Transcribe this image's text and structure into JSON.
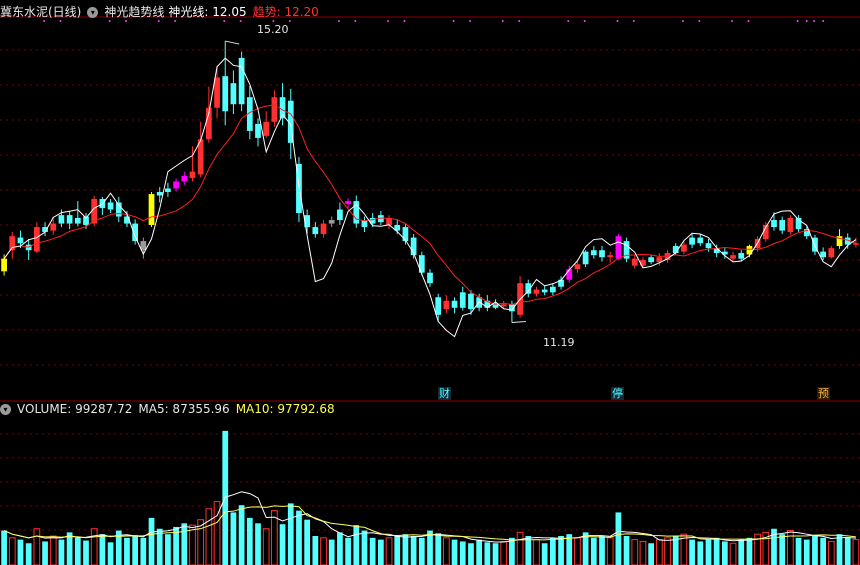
{
  "header": {
    "stock_name": "冀东水泥(日线)",
    "indicator_name": "神光趋势线",
    "line_label": "神光线: 12.05",
    "trend_label": "趋势: 12.20"
  },
  "volume_header": {
    "volume": "VOLUME: 99287.72",
    "ma5": "MA5: 87355.96",
    "ma10": "MA10: 97792.68"
  },
  "annotations": {
    "high": "15.20",
    "low": "11.19",
    "marker_cai": "财",
    "marker_ting": "停",
    "marker_yu": "预"
  },
  "colors": {
    "up": "#ff3030",
    "down": "#54ffff",
    "magenta": "#ff00ff",
    "yellow": "#ffff00",
    "gray": "#9a9a9a",
    "trend_line": "#ff2020",
    "shenguang_line": "#ffffff",
    "ma10_line": "#ffff60"
  },
  "chart_data": {
    "type": "candlestick",
    "y_range": [
      10.3,
      15.5
    ],
    "volume_range": [
      0,
      160000
    ],
    "candles": [
      {
        "o": 11.92,
        "c": 12.1,
        "h": 12.16,
        "l": 11.86,
        "v": 38000,
        "color": "yellow"
      },
      {
        "o": 12.22,
        "c": 12.42,
        "h": 12.48,
        "l": 12.1,
        "v": 30000,
        "color": "up"
      },
      {
        "o": 12.4,
        "c": 12.32,
        "h": 12.5,
        "l": 12.25,
        "v": 28000,
        "color": "down"
      },
      {
        "o": 12.3,
        "c": 12.22,
        "h": 12.38,
        "l": 12.08,
        "v": 24000,
        "color": "down"
      },
      {
        "o": 12.2,
        "c": 12.55,
        "h": 12.62,
        "l": 12.18,
        "v": 40000,
        "color": "up"
      },
      {
        "o": 12.55,
        "c": 12.48,
        "h": 12.62,
        "l": 12.42,
        "v": 26000,
        "color": "down"
      },
      {
        "o": 12.5,
        "c": 12.6,
        "h": 12.7,
        "l": 12.44,
        "v": 32000,
        "color": "up"
      },
      {
        "o": 12.6,
        "c": 12.72,
        "h": 12.8,
        "l": 12.55,
        "v": 28000,
        "color": "down"
      },
      {
        "o": 12.72,
        "c": 12.6,
        "h": 12.78,
        "l": 12.52,
        "v": 36000,
        "color": "down"
      },
      {
        "o": 12.6,
        "c": 12.68,
        "h": 12.92,
        "l": 12.56,
        "v": 30000,
        "color": "down"
      },
      {
        "o": 12.7,
        "c": 12.58,
        "h": 12.75,
        "l": 12.52,
        "v": 27000,
        "color": "down"
      },
      {
        "o": 12.6,
        "c": 12.95,
        "h": 13.0,
        "l": 12.56,
        "v": 40000,
        "color": "up"
      },
      {
        "o": 12.95,
        "c": 12.82,
        "h": 12.98,
        "l": 12.72,
        "v": 34000,
        "color": "down"
      },
      {
        "o": 12.8,
        "c": 12.9,
        "h": 12.95,
        "l": 12.75,
        "v": 25000,
        "color": "down"
      },
      {
        "o": 12.9,
        "c": 12.7,
        "h": 12.98,
        "l": 12.62,
        "v": 38000,
        "color": "down"
      },
      {
        "o": 12.7,
        "c": 12.6,
        "h": 12.78,
        "l": 12.55,
        "v": 30000,
        "color": "down"
      },
      {
        "o": 12.6,
        "c": 12.35,
        "h": 12.66,
        "l": 12.3,
        "v": 33000,
        "color": "down"
      },
      {
        "o": 12.35,
        "c": 12.22,
        "h": 12.4,
        "l": 12.1,
        "v": 30000,
        "color": "gray"
      },
      {
        "o": 12.58,
        "c": 13.02,
        "h": 13.05,
        "l": 12.55,
        "v": 52000,
        "color": "yellow"
      },
      {
        "o": 13.0,
        "c": 13.05,
        "h": 13.12,
        "l": 12.9,
        "v": 40000,
        "color": "down"
      },
      {
        "o": 13.05,
        "c": 13.1,
        "h": 13.18,
        "l": 12.98,
        "v": 34000,
        "color": "down"
      },
      {
        "o": 13.1,
        "c": 13.2,
        "h": 13.24,
        "l": 13.06,
        "v": 42000,
        "color": "magenta"
      },
      {
        "o": 13.2,
        "c": 13.28,
        "h": 13.34,
        "l": 13.15,
        "v": 46000,
        "color": "magenta"
      },
      {
        "o": 13.25,
        "c": 13.34,
        "h": 13.7,
        "l": 13.2,
        "v": 44000,
        "color": "up"
      },
      {
        "o": 13.3,
        "c": 13.8,
        "h": 14.05,
        "l": 13.26,
        "v": 50000,
        "color": "up"
      },
      {
        "o": 13.8,
        "c": 14.25,
        "h": 14.55,
        "l": 13.75,
        "v": 62000,
        "color": "up"
      },
      {
        "o": 14.25,
        "c": 14.68,
        "h": 14.85,
        "l": 14.1,
        "v": 70000,
        "color": "up"
      },
      {
        "o": 14.7,
        "c": 14.2,
        "h": 15.2,
        "l": 14.0,
        "v": 148000,
        "color": "down"
      },
      {
        "o": 14.6,
        "c": 14.3,
        "h": 14.78,
        "l": 14.16,
        "v": 58000,
        "color": "down"
      },
      {
        "o": 14.3,
        "c": 14.96,
        "h": 15.05,
        "l": 14.2,
        "v": 66000,
        "color": "down"
      },
      {
        "o": 14.4,
        "c": 13.92,
        "h": 14.56,
        "l": 13.8,
        "v": 52000,
        "color": "down"
      },
      {
        "o": 14.02,
        "c": 13.82,
        "h": 14.1,
        "l": 13.7,
        "v": 46000,
        "color": "down"
      },
      {
        "o": 13.85,
        "c": 14.05,
        "h": 14.2,
        "l": 13.82,
        "v": 40000,
        "color": "up"
      },
      {
        "o": 14.05,
        "c": 14.4,
        "h": 14.5,
        "l": 13.98,
        "v": 60000,
        "color": "up"
      },
      {
        "o": 14.4,
        "c": 14.1,
        "h": 14.6,
        "l": 14.0,
        "v": 45000,
        "color": "down"
      },
      {
        "o": 14.35,
        "c": 13.75,
        "h": 14.52,
        "l": 13.52,
        "v": 68000,
        "color": "down"
      },
      {
        "o": 13.45,
        "c": 12.75,
        "h": 13.55,
        "l": 12.62,
        "v": 60000,
        "color": "down"
      },
      {
        "o": 12.72,
        "c": 12.55,
        "h": 12.8,
        "l": 12.46,
        "v": 50000,
        "color": "down"
      },
      {
        "o": 12.55,
        "c": 12.45,
        "h": 12.62,
        "l": 12.4,
        "v": 32000,
        "color": "down"
      },
      {
        "o": 12.45,
        "c": 12.6,
        "h": 12.65,
        "l": 12.4,
        "v": 30000,
        "color": "up"
      },
      {
        "o": 12.6,
        "c": 12.65,
        "h": 12.7,
        "l": 12.55,
        "v": 28000,
        "color": "gray"
      },
      {
        "o": 12.65,
        "c": 12.8,
        "h": 12.9,
        "l": 12.58,
        "v": 36000,
        "color": "down"
      },
      {
        "o": 12.88,
        "c": 12.92,
        "h": 12.96,
        "l": 12.82,
        "v": 30000,
        "color": "magenta"
      },
      {
        "o": 12.92,
        "c": 12.6,
        "h": 13.0,
        "l": 12.54,
        "v": 44000,
        "color": "down"
      },
      {
        "o": 12.65,
        "c": 12.55,
        "h": 12.7,
        "l": 12.48,
        "v": 38000,
        "color": "down"
      },
      {
        "o": 12.6,
        "c": 12.68,
        "h": 12.75,
        "l": 12.55,
        "v": 30000,
        "color": "down"
      },
      {
        "o": 12.72,
        "c": 12.62,
        "h": 12.78,
        "l": 12.58,
        "v": 28000,
        "color": "down"
      },
      {
        "o": 12.68,
        "c": 12.58,
        "h": 12.72,
        "l": 12.52,
        "v": 30000,
        "color": "up"
      },
      {
        "o": 12.58,
        "c": 12.5,
        "h": 12.65,
        "l": 12.45,
        "v": 32000,
        "color": "down"
      },
      {
        "o": 12.55,
        "c": 12.35,
        "h": 12.6,
        "l": 12.3,
        "v": 34000,
        "color": "down"
      },
      {
        "o": 12.4,
        "c": 12.15,
        "h": 12.45,
        "l": 12.1,
        "v": 32000,
        "color": "down"
      },
      {
        "o": 12.15,
        "c": 11.9,
        "h": 12.2,
        "l": 11.86,
        "v": 30000,
        "color": "down"
      },
      {
        "o": 11.9,
        "c": 11.75,
        "h": 11.95,
        "l": 11.7,
        "v": 38000,
        "color": "down"
      },
      {
        "o": 11.55,
        "c": 11.3,
        "h": 11.6,
        "l": 11.2,
        "v": 35000,
        "color": "down"
      },
      {
        "o": 11.38,
        "c": 11.5,
        "h": 11.58,
        "l": 11.32,
        "v": 30000,
        "color": "up"
      },
      {
        "o": 11.5,
        "c": 11.4,
        "h": 11.55,
        "l": 11.32,
        "v": 28000,
        "color": "down"
      },
      {
        "o": 11.4,
        "c": 11.62,
        "h": 11.7,
        "l": 11.36,
        "v": 26000,
        "color": "down"
      },
      {
        "o": 11.6,
        "c": 11.38,
        "h": 11.65,
        "l": 11.3,
        "v": 24000,
        "color": "down"
      },
      {
        "o": 11.4,
        "c": 11.55,
        "h": 11.6,
        "l": 11.35,
        "v": 28000,
        "color": "down"
      },
      {
        "o": 11.5,
        "c": 11.4,
        "h": 11.58,
        "l": 11.35,
        "v": 25000,
        "color": "down"
      },
      {
        "o": 11.4,
        "c": 11.45,
        "h": 11.52,
        "l": 11.38,
        "v": 24000,
        "color": "down"
      },
      {
        "o": 11.45,
        "c": 11.42,
        "h": 11.5,
        "l": 11.38,
        "v": 26000,
        "color": "up"
      },
      {
        "o": 11.45,
        "c": 11.35,
        "h": 11.5,
        "l": 11.19,
        "v": 30000,
        "color": "down"
      },
      {
        "o": 11.3,
        "c": 11.75,
        "h": 11.85,
        "l": 11.26,
        "v": 36000,
        "color": "up"
      },
      {
        "o": 11.75,
        "c": 11.6,
        "h": 11.8,
        "l": 11.55,
        "v": 32000,
        "color": "down"
      },
      {
        "o": 11.6,
        "c": 11.66,
        "h": 11.7,
        "l": 11.56,
        "v": 28000,
        "color": "up"
      },
      {
        "o": 11.66,
        "c": 11.62,
        "h": 11.72,
        "l": 11.58,
        "v": 24000,
        "color": "down"
      },
      {
        "o": 11.62,
        "c": 11.7,
        "h": 11.75,
        "l": 11.58,
        "v": 30000,
        "color": "down"
      },
      {
        "o": 11.7,
        "c": 11.8,
        "h": 11.85,
        "l": 11.66,
        "v": 32000,
        "color": "down"
      },
      {
        "o": 11.8,
        "c": 11.95,
        "h": 12.0,
        "l": 11.76,
        "v": 34000,
        "color": "magenta"
      },
      {
        "o": 11.95,
        "c": 12.02,
        "h": 12.06,
        "l": 11.9,
        "v": 30000,
        "color": "up"
      },
      {
        "o": 12.02,
        "c": 12.2,
        "h": 12.22,
        "l": 11.98,
        "v": 36000,
        "color": "down"
      },
      {
        "o": 12.15,
        "c": 12.22,
        "h": 12.28,
        "l": 12.1,
        "v": 30000,
        "color": "down"
      },
      {
        "o": 12.22,
        "c": 12.12,
        "h": 12.28,
        "l": 12.06,
        "v": 32000,
        "color": "down"
      },
      {
        "o": 12.12,
        "c": 12.15,
        "h": 12.2,
        "l": 12.04,
        "v": 30000,
        "color": "up"
      },
      {
        "o": 12.1,
        "c": 12.42,
        "h": 12.45,
        "l": 12.08,
        "v": 58000,
        "color": "magenta"
      },
      {
        "o": 12.35,
        "c": 12.1,
        "h": 12.4,
        "l": 12.05,
        "v": 32000,
        "color": "down"
      },
      {
        "o": 12.1,
        "c": 12.0,
        "h": 12.15,
        "l": 11.96,
        "v": 28000,
        "color": "up"
      },
      {
        "o": 12.0,
        "c": 12.08,
        "h": 12.12,
        "l": 11.96,
        "v": 26000,
        "color": "up"
      },
      {
        "o": 12.05,
        "c": 12.12,
        "h": 12.15,
        "l": 12.02,
        "v": 24000,
        "color": "down"
      },
      {
        "o": 12.12,
        "c": 12.05,
        "h": 12.18,
        "l": 12.0,
        "v": 28000,
        "color": "up"
      },
      {
        "o": 12.08,
        "c": 12.18,
        "h": 12.22,
        "l": 12.04,
        "v": 30000,
        "color": "up"
      },
      {
        "o": 12.18,
        "c": 12.28,
        "h": 12.32,
        "l": 12.15,
        "v": 32000,
        "color": "down"
      },
      {
        "o": 12.2,
        "c": 12.3,
        "h": 12.35,
        "l": 12.16,
        "v": 34000,
        "color": "up"
      },
      {
        "o": 12.3,
        "c": 12.4,
        "h": 12.45,
        "l": 12.25,
        "v": 28000,
        "color": "down"
      },
      {
        "o": 12.4,
        "c": 12.32,
        "h": 12.45,
        "l": 12.28,
        "v": 26000,
        "color": "down"
      },
      {
        "o": 12.32,
        "c": 12.25,
        "h": 12.38,
        "l": 12.2,
        "v": 28000,
        "color": "down"
      },
      {
        "o": 12.25,
        "c": 12.18,
        "h": 12.3,
        "l": 12.12,
        "v": 30000,
        "color": "down"
      },
      {
        "o": 12.2,
        "c": 12.16,
        "h": 12.25,
        "l": 12.1,
        "v": 26000,
        "color": "down"
      },
      {
        "o": 12.15,
        "c": 12.1,
        "h": 12.2,
        "l": 12.05,
        "v": 24000,
        "color": "up"
      },
      {
        "o": 12.1,
        "c": 12.18,
        "h": 12.22,
        "l": 12.06,
        "v": 28000,
        "color": "down"
      },
      {
        "o": 12.16,
        "c": 12.28,
        "h": 12.3,
        "l": 12.12,
        "v": 30000,
        "color": "yellow"
      },
      {
        "o": 12.25,
        "c": 12.38,
        "h": 12.42,
        "l": 12.2,
        "v": 34000,
        "color": "up"
      },
      {
        "o": 12.38,
        "c": 12.58,
        "h": 12.62,
        "l": 12.34,
        "v": 36000,
        "color": "up"
      },
      {
        "o": 12.55,
        "c": 12.65,
        "h": 12.76,
        "l": 12.5,
        "v": 40000,
        "color": "down"
      },
      {
        "o": 12.65,
        "c": 12.5,
        "h": 12.7,
        "l": 12.45,
        "v": 34000,
        "color": "down"
      },
      {
        "o": 12.48,
        "c": 12.68,
        "h": 12.72,
        "l": 12.44,
        "v": 38000,
        "color": "up"
      },
      {
        "o": 12.68,
        "c": 12.52,
        "h": 12.72,
        "l": 12.48,
        "v": 30000,
        "color": "down"
      },
      {
        "o": 12.52,
        "c": 12.42,
        "h": 12.56,
        "l": 12.38,
        "v": 28000,
        "color": "down"
      },
      {
        "o": 12.4,
        "c": 12.2,
        "h": 12.44,
        "l": 12.15,
        "v": 32000,
        "color": "down"
      },
      {
        "o": 12.2,
        "c": 12.12,
        "h": 12.26,
        "l": 12.08,
        "v": 30000,
        "color": "down"
      },
      {
        "o": 12.12,
        "c": 12.25,
        "h": 12.28,
        "l": 12.1,
        "v": 26000,
        "color": "up"
      },
      {
        "o": 12.28,
        "c": 12.42,
        "h": 12.52,
        "l": 12.24,
        "v": 34000,
        "color": "yellow"
      },
      {
        "o": 12.4,
        "c": 12.3,
        "h": 12.46,
        "l": 12.24,
        "v": 30000,
        "color": "down"
      },
      {
        "o": 12.3,
        "c": 12.32,
        "h": 12.4,
        "l": 12.26,
        "v": 28000,
        "color": "up"
      }
    ]
  }
}
